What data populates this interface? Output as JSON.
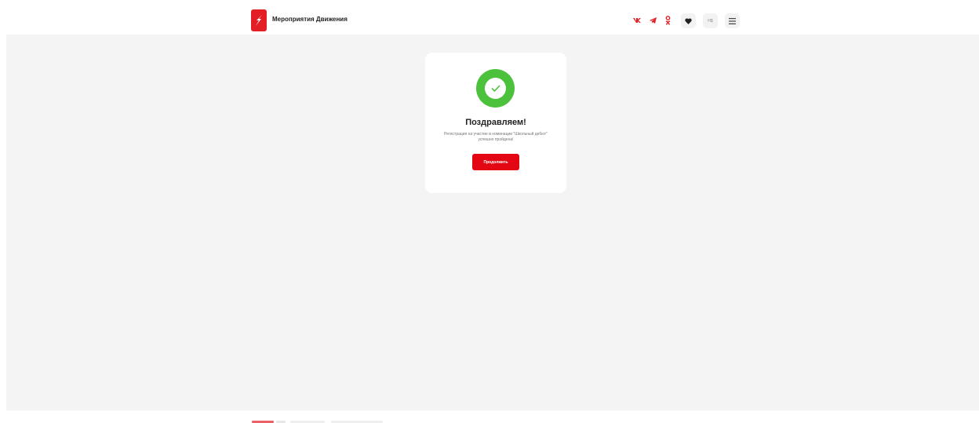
{
  "header": {
    "title": "Мероприятия Движения",
    "accessibility_label": "Н$",
    "icons": {
      "logo": "movement-logo-icon",
      "vk": "vk-icon",
      "telegram": "telegram-icon",
      "odnoklassniki": "odnoklassniki-icon",
      "favorites": "heart-icon",
      "menu": "hamburger-menu-icon"
    }
  },
  "card": {
    "title": "Поздравляем!",
    "message": "Регистрация на участие в номинации \"Школьный дебют\" успешно пройдена!",
    "button_label": "Продолжить",
    "icon": "check-circle-icon"
  },
  "colors": {
    "brand_red": "#e31e24",
    "success_green": "#4cc13b",
    "background": "#f4f4f4"
  }
}
